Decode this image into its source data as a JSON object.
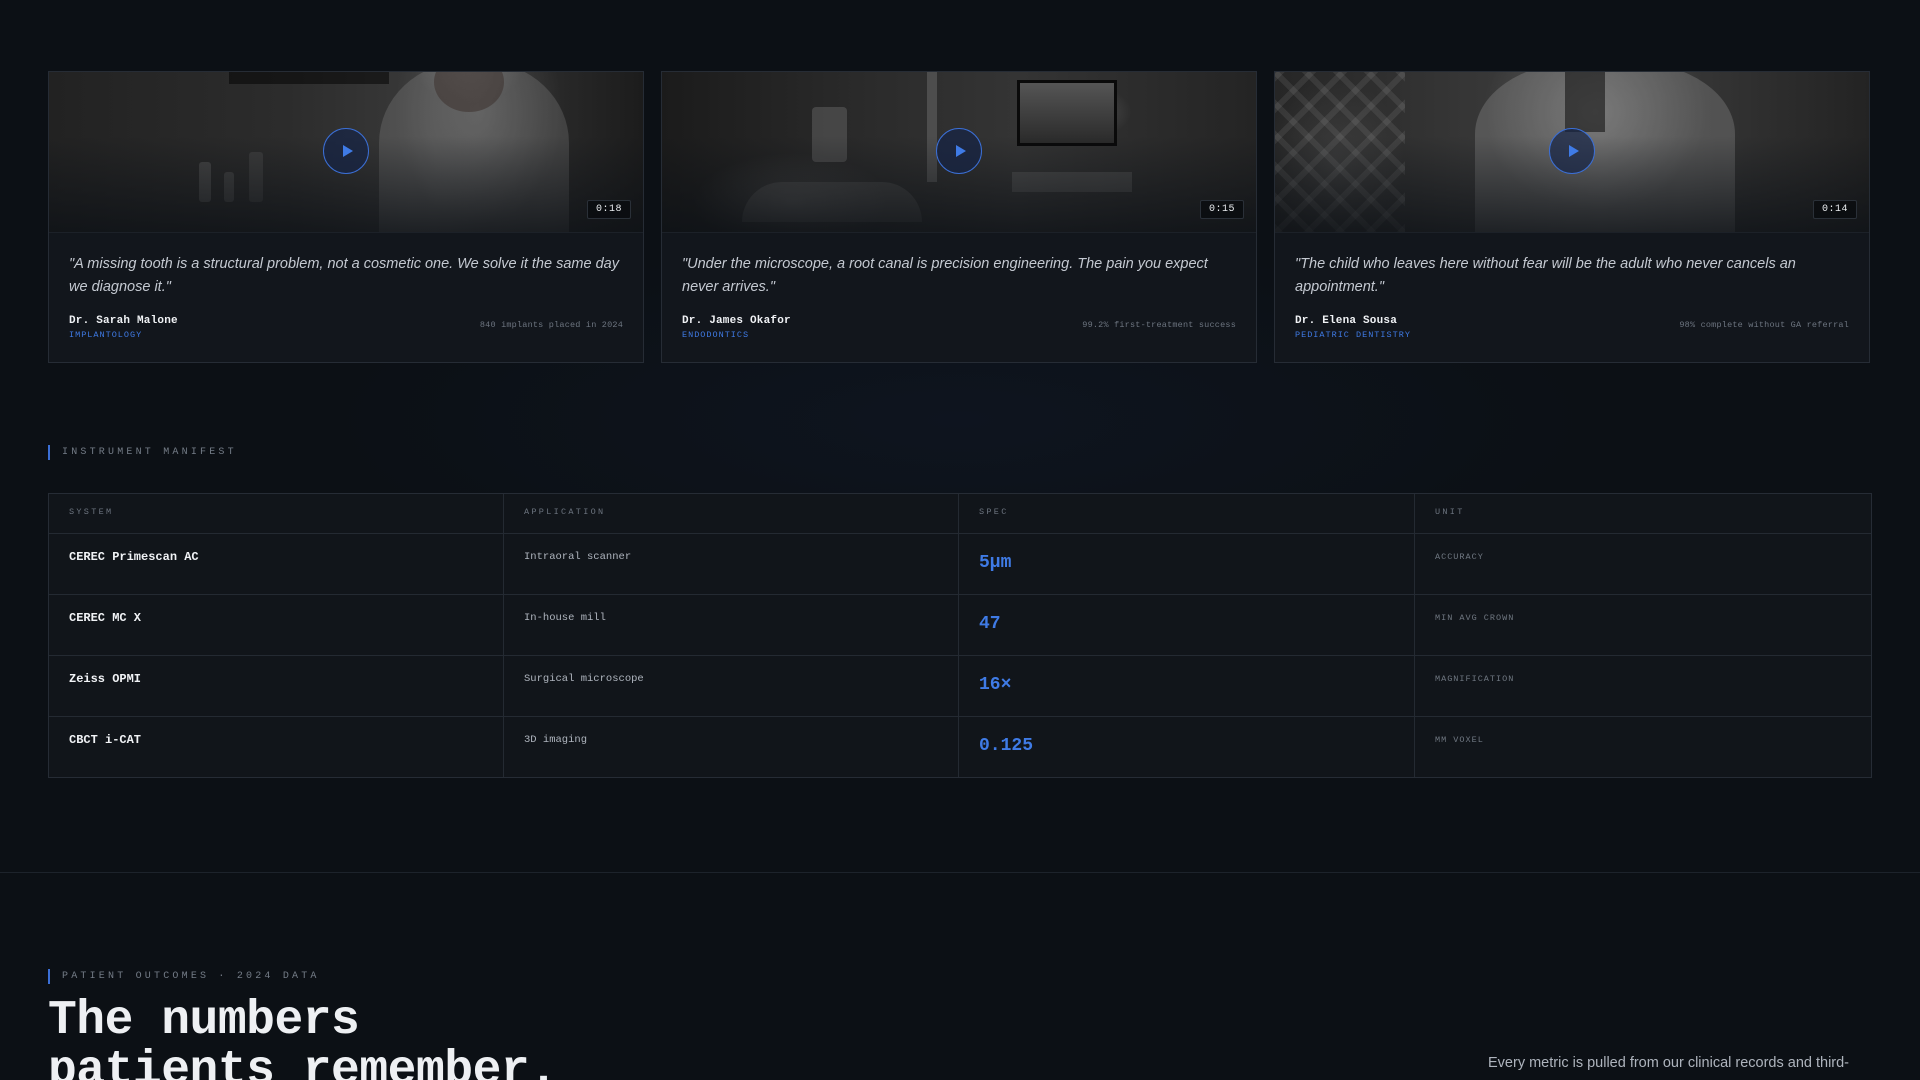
{
  "testimonials": [
    {
      "duration": "0:18",
      "quote": "\"A missing tooth is a structural problem, not a cosmetic one. We solve it the same day we diagnose it.\"",
      "doctor": "Dr. Sarah Malone",
      "specialty": "IMPLANTOLOGY",
      "stat": "840 implants placed in 2024"
    },
    {
      "duration": "0:15",
      "quote": "\"Under the microscope, a root canal is precision engineering. The pain you expect never arrives.\"",
      "doctor": "Dr. James Okafor",
      "specialty": "ENDODONTICS",
      "stat": "99.2% first-treatment success"
    },
    {
      "duration": "0:14",
      "quote": "\"The child who leaves here without fear will be the adult who never cancels an appointment.\"",
      "doctor": "Dr. Elena Sousa",
      "specialty": "PEDIATRIC DENTISTRY",
      "stat": "98% complete without GA referral"
    }
  ],
  "manifest": {
    "label": "INSTRUMENT MANIFEST",
    "columns": [
      "SYSTEM",
      "APPLICATION",
      "SPEC",
      "UNIT"
    ],
    "rows": [
      {
        "system": "CEREC Primescan AC",
        "application": "Intraoral scanner",
        "spec": "5µm",
        "unit": "ACCURACY"
      },
      {
        "system": "CEREC MC X",
        "application": "In-house mill",
        "spec": "47",
        "unit": "MIN AVG CROWN"
      },
      {
        "system": "Zeiss OPMI",
        "application": "Surgical microscope",
        "spec": "16×",
        "unit": "MAGNIFICATION"
      },
      {
        "system": "CBCT i-CAT",
        "application": "3D imaging",
        "spec": "0.125",
        "unit": "MM VOXEL"
      }
    ]
  },
  "outcomes": {
    "label": "PATIENT OUTCOMES · 2024 DATA",
    "headline": "The numbers\npatients remember.",
    "blurb": "Every metric is pulled from our clinical records and third-party"
  },
  "colors": {
    "accent": "#3f7be6",
    "background": "#0c1015",
    "card": "#12161c",
    "border": "#262c35"
  },
  "icons": {
    "play": "play-icon"
  }
}
